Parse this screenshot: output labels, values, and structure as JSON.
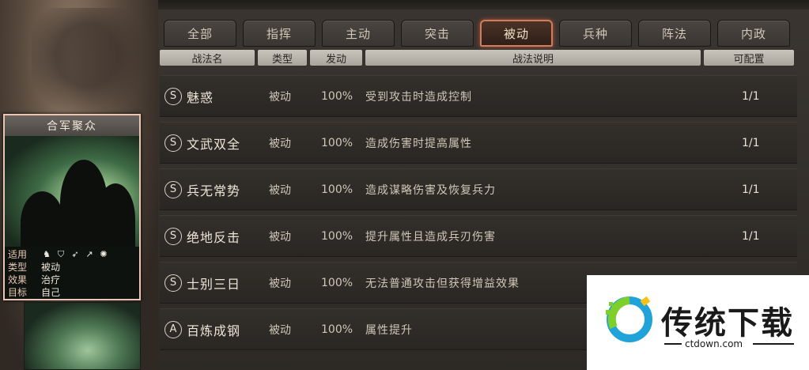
{
  "tabs": [
    {
      "label": "全部",
      "active": false
    },
    {
      "label": "指挥",
      "active": false
    },
    {
      "label": "主动",
      "active": false
    },
    {
      "label": "突击",
      "active": false
    },
    {
      "label": "被动",
      "active": true
    },
    {
      "label": "兵种",
      "active": false
    },
    {
      "label": "阵法",
      "active": false
    },
    {
      "label": "内政",
      "active": false
    }
  ],
  "columns": {
    "name": "战法名",
    "type": "类型",
    "rate": "发动",
    "desc": "战法说明",
    "count": "可配置"
  },
  "rows": [
    {
      "grade": "S",
      "name": "魅惑",
      "type": "被动",
      "rate": "100%",
      "desc": "受到攻击时造成控制",
      "count": "1/1"
    },
    {
      "grade": "S",
      "name": "文武双全",
      "type": "被动",
      "rate": "100%",
      "desc": "造成伤害时提高属性",
      "count": "1/1"
    },
    {
      "grade": "S",
      "name": "兵无常势",
      "type": "被动",
      "rate": "100%",
      "desc": "造成谋略伤害及恢复兵力",
      "count": "1/1"
    },
    {
      "grade": "S",
      "name": "绝地反击",
      "type": "被动",
      "rate": "100%",
      "desc": "提升属性且造成兵刃伤害",
      "count": "1/1"
    },
    {
      "grade": "S",
      "name": "士别三日",
      "type": "被动",
      "rate": "100%",
      "desc": "无法普通攻击但获得增益效果",
      "count": ""
    },
    {
      "grade": "A",
      "name": "百炼成钢",
      "type": "被动",
      "rate": "100%",
      "desc": "属性提升",
      "count": ""
    }
  ],
  "card": {
    "title": "合军聚众",
    "labels": {
      "apply": "适用",
      "type": "类型",
      "effect": "效果",
      "target": "目标"
    },
    "type": "被动",
    "effect": "治疗",
    "target": "自己",
    "unit_icons": [
      "cavalry-icon",
      "shield-icon",
      "archer-icon",
      "spear-icon",
      "siege-icon"
    ]
  },
  "watermark": {
    "title": "传统下载",
    "domain": "ctdown.com"
  }
}
